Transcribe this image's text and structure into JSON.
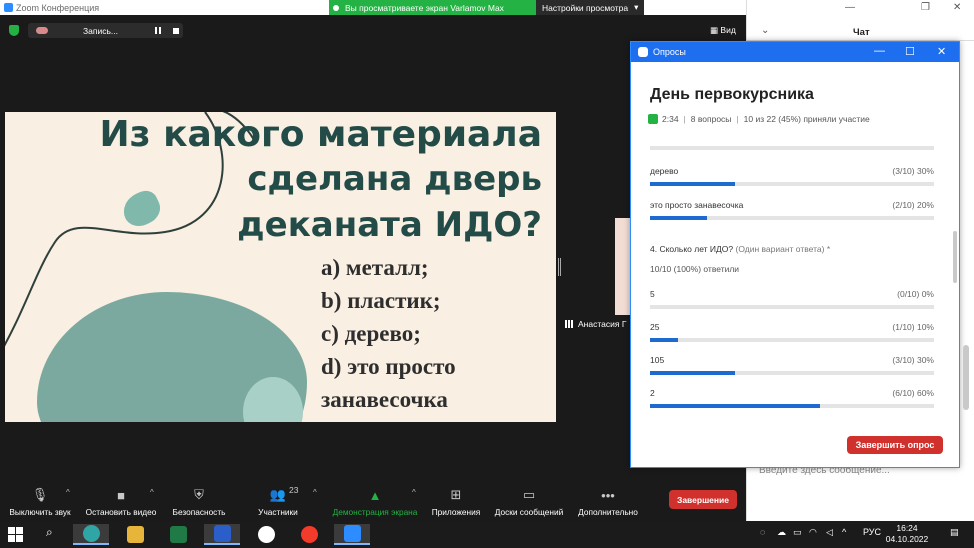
{
  "window": {
    "title": "Zoom Конференция",
    "share_banner": "Вы просматриваете экран Varlamov Max",
    "view_settings": "Настройки просмотра"
  },
  "topbar": {
    "recording_label": "Запись...",
    "view_label": "Вид"
  },
  "slide": {
    "question_lines": [
      "Из какого материала",
      "сделана дверь",
      "деканата ИДО?"
    ],
    "answers": [
      "a) металл;",
      "b) пластик;",
      "c) дерево;",
      "d) это просто",
      "занавесочка"
    ]
  },
  "participant": {
    "name": "Анастасия Г"
  },
  "toolbar": {
    "mute": "Выключить звук",
    "stop_video": "Остановить видео",
    "security": "Безопасность",
    "participants": "Участники",
    "participants_count": "23",
    "share_screen": "Демонстрация экрана",
    "apps": "Приложения",
    "whiteboards": "Доски сообщений",
    "more": "Дополнительно",
    "end": "Завершение"
  },
  "chat": {
    "title": "Чат",
    "input_placeholder": "Введите здесь сообщение..."
  },
  "polls": {
    "window_title": "Опросы",
    "poll_title": "День первокурсника",
    "elapsed": "2:34",
    "questions": "8 вопросы",
    "participation": "10 из 22 (45%) приняли участие",
    "prev_options": [
      {
        "label": "дерево",
        "result": "(3/10) 30%",
        "percent": 30
      },
      {
        "label": "это просто занавесочка",
        "result": "(2/10) 20%",
        "percent": 20
      }
    ],
    "question4": "4. Сколько лет ИДО?",
    "question4_hint": "(Один вариант ответа) *",
    "answered": "10/10 (100%) ответили",
    "q4_options": [
      {
        "label": "5",
        "result": "(0/10) 0%",
        "percent": 0
      },
      {
        "label": "25",
        "result": "(1/10) 10%",
        "percent": 10
      },
      {
        "label": "105",
        "result": "(3/10) 30%",
        "percent": 30
      },
      {
        "label": "2",
        "result": "(6/10) 60%",
        "percent": 60
      }
    ],
    "end_button": "Завершить опрос"
  },
  "taskbar": {
    "language": "РУС",
    "time": "16:24",
    "date": "04.10.2022"
  },
  "colors": {
    "zoom_blue": "#1e6ff0",
    "share_green": "#23b243",
    "end_red": "#d0312d",
    "slide_bg": "#f9efe2",
    "slide_text": "#234b47"
  }
}
